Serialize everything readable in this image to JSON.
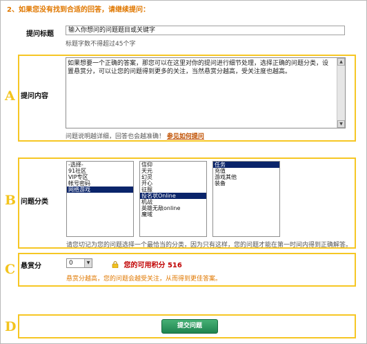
{
  "heading": "2、如果您没有找到合适的回答，请继续提问：",
  "title_field": {
    "label": "提问标题",
    "value": "输入你想问的问题题目或关键字",
    "hint": "标题字数不得超过45个字"
  },
  "sections": {
    "a": "A",
    "b": "B",
    "c": "C",
    "d": "D"
  },
  "content_field": {
    "label": "提问内容",
    "line1": "如果想要一个正确的答案，那您可以在这里对你的提问进行细节处理，选择正确的问题分类，设",
    "line2": "置悬赏分，可以让您的问题得到更多的关注，当然悬赏分越高，受关注度也越高。",
    "hint": "问题说明越详细，回答也会越准确！",
    "link": "参见如何提问"
  },
  "category": {
    "label": "问题分类",
    "list1": [
      {
        "label": "-选择-",
        "selected": false
      },
      {
        "label": "91社区",
        "selected": false
      },
      {
        "label": "VIP专区",
        "selected": false
      },
      {
        "label": "帐号密码",
        "selected": false
      },
      {
        "label": "网络游戏",
        "selected": true
      }
    ],
    "list2": [
      {
        "label": "信仰",
        "selected": false
      },
      {
        "label": "天元",
        "selected": false
      },
      {
        "label": "幻灵",
        "selected": false
      },
      {
        "label": "开心",
        "selected": false
      },
      {
        "label": "征服",
        "selected": false
      },
      {
        "label": "投名状Online",
        "selected": true
      },
      {
        "label": "机战",
        "selected": false
      },
      {
        "label": "英雄无敌online",
        "selected": false
      },
      {
        "label": "魔域",
        "selected": false
      }
    ],
    "list3": [
      {
        "label": "任务",
        "selected": true
      },
      {
        "label": "充值",
        "selected": false
      },
      {
        "label": "游戏其他",
        "selected": false
      },
      {
        "label": "装备",
        "selected": false
      }
    ],
    "hint": "请您切记为您的问题选择一个最恰当的分类，因为只有这样，您的问题才能在第一时间内得到正确解答。"
  },
  "reward": {
    "label": "悬赏分",
    "value": "0",
    "points_label": "您的可用积分",
    "points_value": "516",
    "hint": "悬赏分越高，您的问题会越受关注，从而得到更佳答案。"
  },
  "submit_label": "提交问题",
  "colors": {
    "accent_orange": "#e07800",
    "section_border": "#f6c623",
    "selected_bg": "#0a246a",
    "submit_green": "#2f9a5f",
    "points_red": "#c00000"
  },
  "icons": {
    "points": "lock-icon",
    "scroll_up": "arrow-up-icon",
    "scroll_down": "arrow-down-icon",
    "dropdown": "chevron-down-icon"
  }
}
